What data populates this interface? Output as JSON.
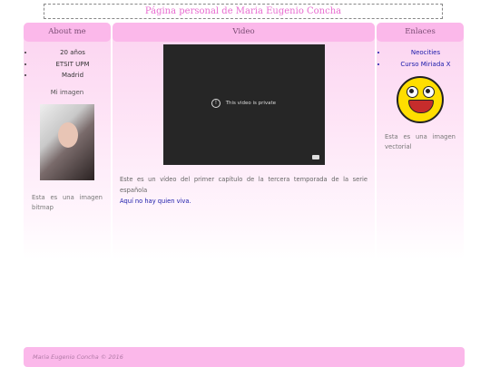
{
  "header": {
    "title": "Página personal de Maria Eugenio Concha"
  },
  "left": {
    "heading": "About me",
    "facts": [
      "20 años",
      "ETSIT UPM",
      "Madrid"
    ],
    "image_caption": "Mi imagen",
    "bitmap_text": "Esta es una imagen bitmap"
  },
  "middle": {
    "heading": "Video",
    "video_message": "This video is private",
    "description": "Este es un vídeo del primer capítulo de la tercera temporada de la serie española",
    "link_text": "Aquí no hay quien viva."
  },
  "right": {
    "heading": "Enlaces",
    "links": [
      "Neocities",
      "Curso Miriada X"
    ],
    "vector_text": "Esta es una imagen vectorial"
  },
  "footer": {
    "text": "Maria Eugenio Concha © 2016"
  },
  "colors": {
    "accent": "#fbb8ea",
    "title": "#e86bd0",
    "link": "#1a1aaa"
  }
}
